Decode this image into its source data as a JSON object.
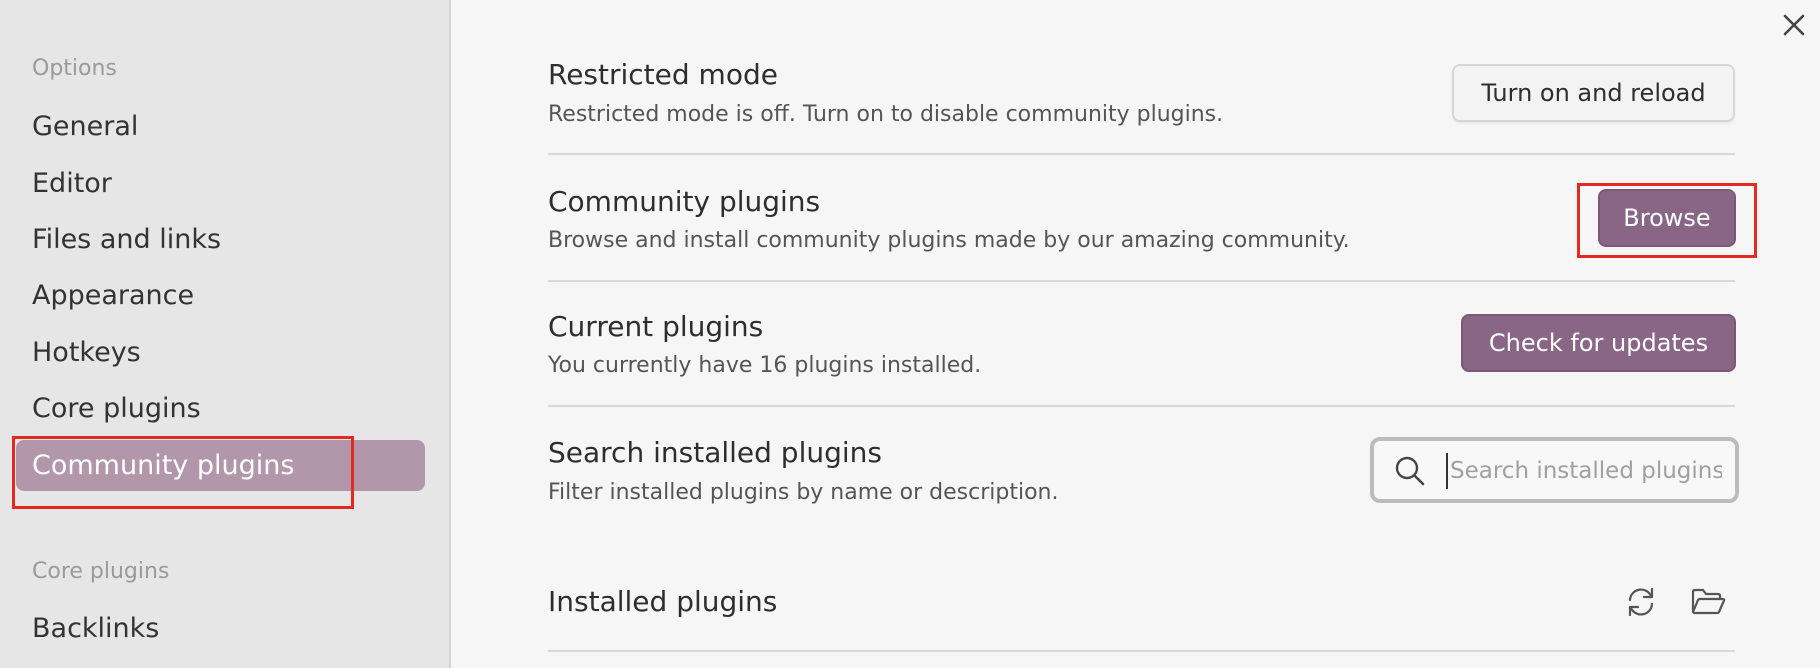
{
  "sidebar": {
    "section_options": "Options",
    "items": [
      {
        "label": "General"
      },
      {
        "label": "Editor"
      },
      {
        "label": "Files and links"
      },
      {
        "label": "Appearance"
      },
      {
        "label": "Hotkeys"
      },
      {
        "label": "Core plugins"
      },
      {
        "label": "Community plugins",
        "active": true
      }
    ],
    "section_core_plugins": "Core plugins",
    "core_items": [
      {
        "label": "Backlinks"
      }
    ]
  },
  "settings": {
    "restricted_mode": {
      "name": "Restricted mode",
      "description": "Restricted mode is off. Turn on to disable community plugins.",
      "button": "Turn on and reload"
    },
    "community_plugins": {
      "name": "Community plugins",
      "description": "Browse and install community plugins made by our amazing community.",
      "button": "Browse"
    },
    "current_plugins": {
      "name": "Current plugins",
      "description": "You currently have 16 plugins installed.",
      "button": "Check for updates"
    },
    "search_plugins": {
      "name": "Search installed plugins",
      "description": "Filter installed plugins by name or description.",
      "placeholder": "Search installed plugins",
      "value": ""
    }
  },
  "installed": {
    "heading": "Installed plugins"
  },
  "icons": {
    "close": "close-icon",
    "search": "search-icon",
    "reload": "reload-icon",
    "folder": "folder-open-icon"
  },
  "colors": {
    "accent": "#8a6686",
    "active_item": "#b297ab",
    "highlight": "#e32a22"
  }
}
